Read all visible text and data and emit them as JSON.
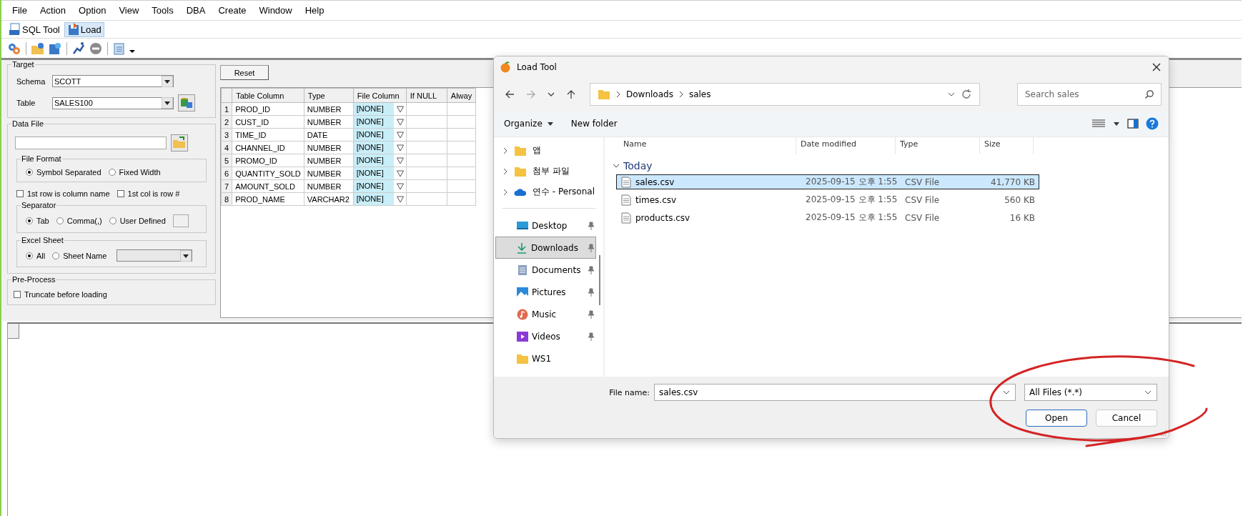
{
  "menu_bar": [
    "File",
    "Action",
    "Option",
    "View",
    "Tools",
    "DBA",
    "Create",
    "Window",
    "Help"
  ],
  "tabs": [
    {
      "label": "SQL Tool",
      "selected": false
    },
    {
      "label": "Load",
      "selected": true
    }
  ],
  "target": {
    "title": "Target",
    "schema_label": "Schema",
    "schema": "SCOTT",
    "table_label": "Table",
    "table": "SALES100"
  },
  "data_file": {
    "title": "Data File",
    "file_format": {
      "title": "File Format",
      "options": [
        {
          "label": "Symbol Separated",
          "selected": true
        },
        {
          "label": "Fixed Width",
          "selected": false
        }
      ]
    },
    "checkboxes": [
      {
        "label": "1st row is column name",
        "checked": false
      },
      {
        "label": "1st col is row #",
        "checked": false
      }
    ],
    "separator": {
      "title": "Separator",
      "options": [
        {
          "label": "Tab",
          "selected": true
        },
        {
          "label": "Comma(,)",
          "selected": false
        },
        {
          "label": "User Defined",
          "selected": false
        }
      ]
    },
    "excel_sheet": {
      "title": "Excel Sheet",
      "options": [
        {
          "label": "All",
          "selected": true
        },
        {
          "label": "Sheet Name",
          "selected": false
        }
      ]
    }
  },
  "pre_process": {
    "title": "Pre-Process",
    "checkboxes": [
      {
        "label": "Truncate before loading",
        "checked": false
      }
    ]
  },
  "reset_button": "Reset",
  "grid": {
    "columns": [
      "Table Column",
      "Type",
      "File Column",
      "If NULL",
      "Alway"
    ],
    "rows": [
      {
        "number": "1",
        "table_column": "PROD_ID",
        "type": "NUMBER",
        "file_column": "[NONE]"
      },
      {
        "number": "2",
        "table_column": "CUST_ID",
        "type": "NUMBER",
        "file_column": "[NONE]"
      },
      {
        "number": "3",
        "table_column": "TIME_ID",
        "type": "DATE",
        "file_column": "[NONE]"
      },
      {
        "number": "4",
        "table_column": "CHANNEL_ID",
        "type": "NUMBER",
        "file_column": "[NONE]"
      },
      {
        "number": "5",
        "table_column": "PROMO_ID",
        "type": "NUMBER",
        "file_column": "[NONE]"
      },
      {
        "number": "6",
        "table_column": "QUANTITY_SOLD",
        "type": "NUMBER",
        "file_column": "[NONE]"
      },
      {
        "number": "7",
        "table_column": "AMOUNT_SOLD",
        "type": "NUMBER",
        "file_column": "[NONE]"
      },
      {
        "number": "8",
        "table_column": "PROD_NAME",
        "type": "VARCHAR2",
        "file_column": "[NONE]"
      }
    ]
  },
  "dialog": {
    "title": "Load Tool",
    "breadcrumb": [
      "Downloads",
      "sales"
    ],
    "search": {
      "placeholder": "Search sales"
    },
    "commands": [
      "Organize",
      "New folder"
    ],
    "nav_tree": [
      {
        "label": "앱",
        "kind": "folder"
      },
      {
        "label": "첨부 파일",
        "kind": "folder"
      },
      {
        "label": "연수 - Personal",
        "kind": "cloud"
      }
    ],
    "quick_access": [
      {
        "label": "Desktop",
        "kind": "desktop",
        "selected": false
      },
      {
        "label": "Downloads",
        "kind": "downloads",
        "selected": true
      },
      {
        "label": "Documents",
        "kind": "documents",
        "selected": false
      },
      {
        "label": "Pictures",
        "kind": "pictures",
        "selected": false
      },
      {
        "label": "Music",
        "kind": "music",
        "selected": false
      },
      {
        "label": "Videos",
        "kind": "videos",
        "selected": false
      },
      {
        "label": "WS1",
        "kind": "folder",
        "selected": false
      }
    ],
    "columns": [
      "Name",
      "Date modified",
      "Type",
      "Size"
    ],
    "group": "Today",
    "files": [
      {
        "name": "sales.csv",
        "date": "2025-09-15 오후 1:55",
        "type": "CSV File",
        "size": "41,770 KB",
        "selected": true
      },
      {
        "name": "times.csv",
        "date": "2025-09-15 오후 1:55",
        "type": "CSV File",
        "size": "560 KB",
        "selected": false
      },
      {
        "name": "products.csv",
        "date": "2025-09-15 오후 1:55",
        "type": "CSV File",
        "size": "16 KB",
        "selected": false
      }
    ],
    "file_name_label": "File name:",
    "file_name": "sales.csv",
    "filter": "All Files (*.*)",
    "buttons": [
      "Open",
      "Cancel"
    ]
  }
}
